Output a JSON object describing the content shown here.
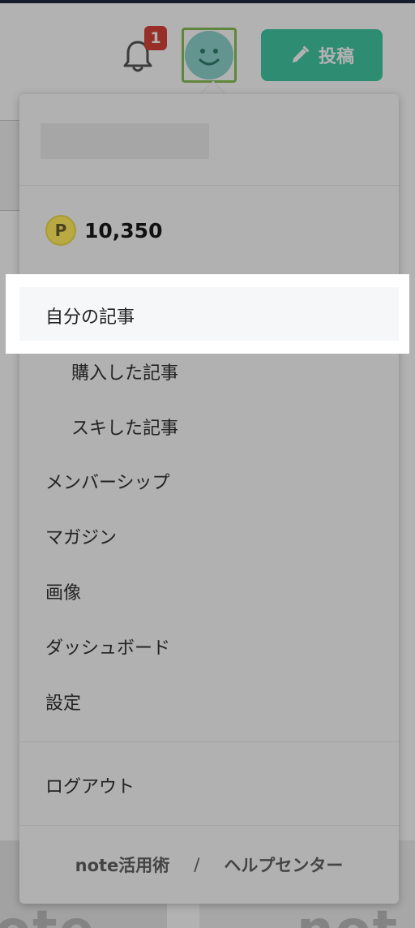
{
  "header": {
    "notification_count": "1",
    "post_label": "投稿"
  },
  "points": {
    "icon_letter": "P",
    "value": "10,350"
  },
  "menu": {
    "items": [
      {
        "label": "自分の記事"
      },
      {
        "label": "購入した記事"
      },
      {
        "label": "スキした記事"
      },
      {
        "label": "メンバーシップ"
      },
      {
        "label": "マガジン"
      },
      {
        "label": "画像"
      },
      {
        "label": "ダッシュボード"
      },
      {
        "label": "設定"
      }
    ],
    "logout_label": "ログアウト"
  },
  "footer": {
    "link1": "note活用術",
    "separator": "/",
    "link2": "ヘルプセンター"
  },
  "colors": {
    "accent": "#41c9a3",
    "badge": "#d8443a",
    "avatar_border": "#88c057",
    "points_coin": "#b8a943"
  },
  "icons": {
    "bell": "bell-icon",
    "avatar": "smiley-avatar-icon",
    "post": "pencil-icon",
    "points": "point-coin-icon"
  }
}
